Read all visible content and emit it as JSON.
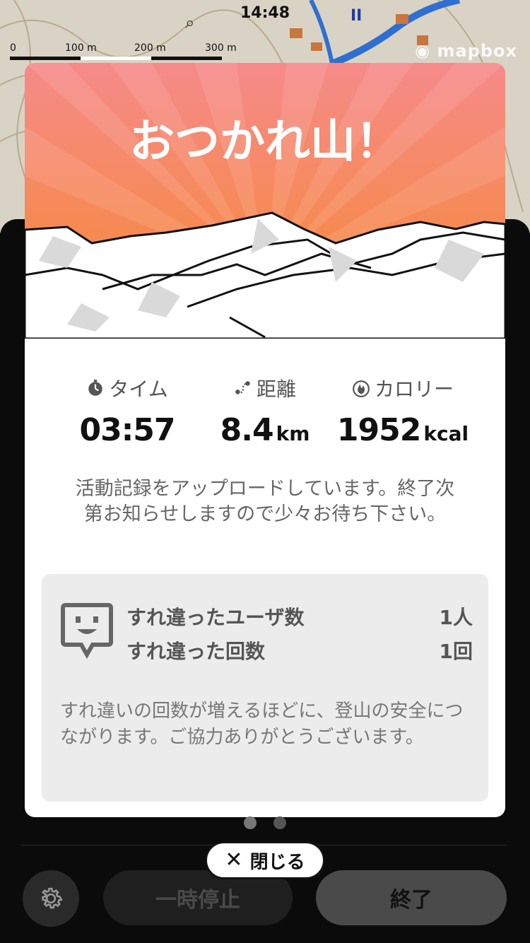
{
  "status_bar": {
    "time": "14:48"
  },
  "map": {
    "scale_labels": [
      "0",
      "100 m",
      "200 m",
      "300 m"
    ],
    "attribution": "mapbox"
  },
  "modal": {
    "title": "おつかれ山！",
    "stats": [
      {
        "label": "タイム",
        "icon": "stopwatch-icon",
        "value": "03:57",
        "unit": ""
      },
      {
        "label": "距離",
        "icon": "route-icon",
        "value": "8.4",
        "unit": "km"
      },
      {
        "label": "カロリー",
        "icon": "flame-icon",
        "value": "1952",
        "unit": "kcal"
      }
    ],
    "upload_message": "活動記録をアップロードしています。終了次第お知らせしますので少々お待ち下さい。",
    "passing": {
      "users_label": "すれ違ったユーザ数",
      "users_value": "1人",
      "count_label": "すれ違った回数",
      "count_value": "1回",
      "note": "すれ違いの回数が増えるほどに、登山の安全につながります。ご協力ありがとうございます。"
    },
    "header_gradient": {
      "top": "#f58a8a",
      "bottom": "#f7892e"
    }
  },
  "pagination": {
    "pages": 2,
    "current": 1
  },
  "controls": {
    "close_label": "閉じる",
    "pause_label": "一時停止",
    "end_label": "終了"
  }
}
